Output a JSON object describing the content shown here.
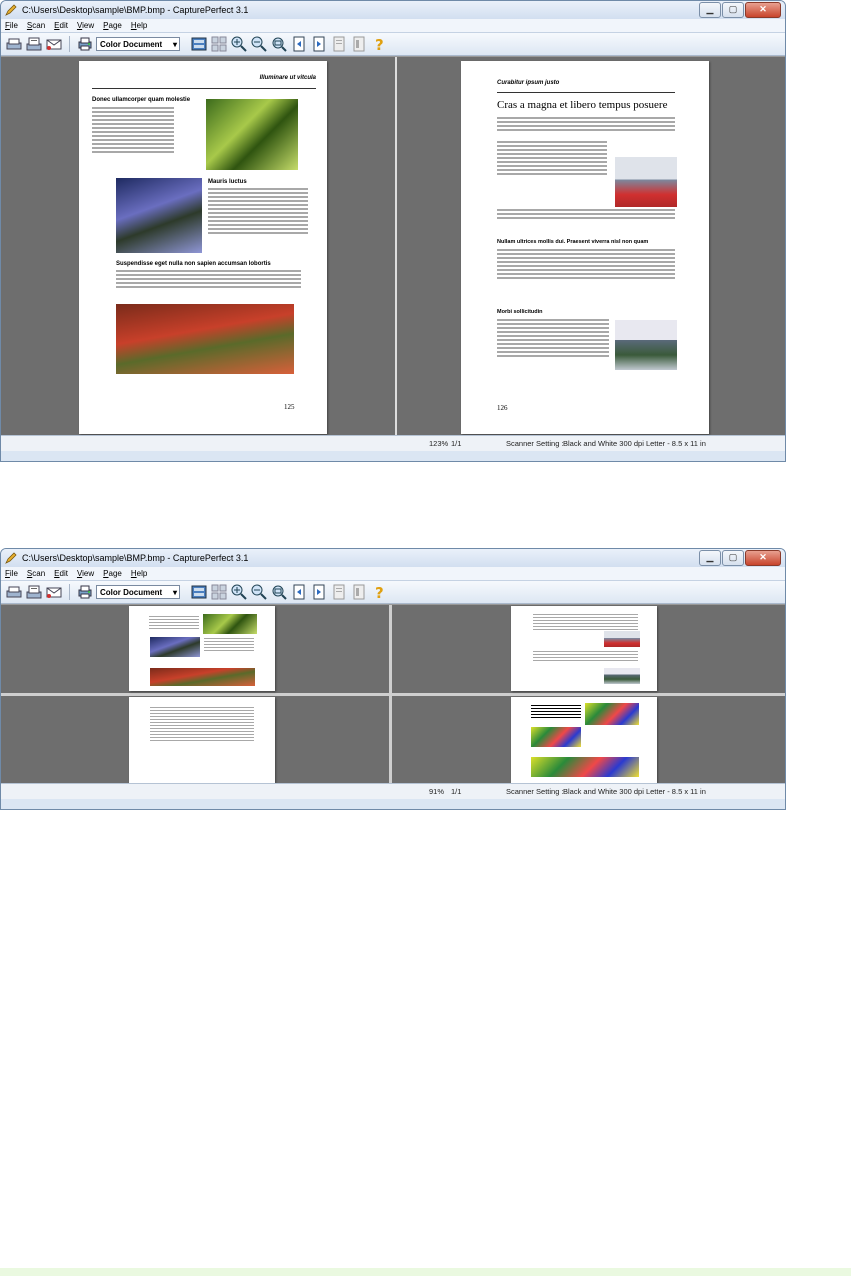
{
  "window": {
    "title": "C:\\Users\\Desktop\\sample\\BMP.bmp - CapturePerfect 3.1",
    "controls": [
      "minimize",
      "maximize",
      "close"
    ]
  },
  "menu": [
    "File",
    "Scan",
    "Edit",
    "View",
    "Page",
    "Help"
  ],
  "toolbar": {
    "icons": [
      "scan-icon",
      "scan-batch-icon",
      "email-icon",
      "print-icon",
      "single-view-icon",
      "multi-view-icon",
      "zoom-in-icon",
      "zoom-out-icon",
      "zoom-fit-icon",
      "page-prev-icon",
      "page-next-icon",
      "page-grid-icon",
      "page-sheet-icon",
      "help-icon"
    ],
    "profile": "Color Document"
  },
  "documents": {
    "left_header": "Illuminare ut vitcula",
    "left_h1": "Donec ullamcorper quam molestie",
    "left_h2": "Mauris luctus",
    "left_h3": "Suspendisse eget nulla non sapien accumsan lobortis",
    "left_pagenum": "125",
    "right_header": "Curabitur ipsum justo",
    "right_title": "Cras a magna et libero tempus posuere",
    "right_h2": "Nullam ultrices mollis dui. Praesent viverra nisl non quam",
    "right_h3": "Morbi sollicitudin",
    "right_pagenum": "126"
  },
  "screen1": {
    "zoom": "123%",
    "pages": "1/1",
    "scanner_label": "Scanner Setting :",
    "scanner_value": "Black and White  300 dpi  Letter - 8.5 x 11 in"
  },
  "screen2": {
    "zoom": "91%",
    "pages": "1/1",
    "scanner_label": "Scanner Setting :",
    "scanner_value": "Black and White  300 dpi  Letter - 8.5 x 11 in"
  },
  "colors": {
    "viewer_bg": "#6e6e6e",
    "chrome": "#dbe6f3",
    "close_button": "#c8442c",
    "footer_band": "#eaf9e0"
  }
}
